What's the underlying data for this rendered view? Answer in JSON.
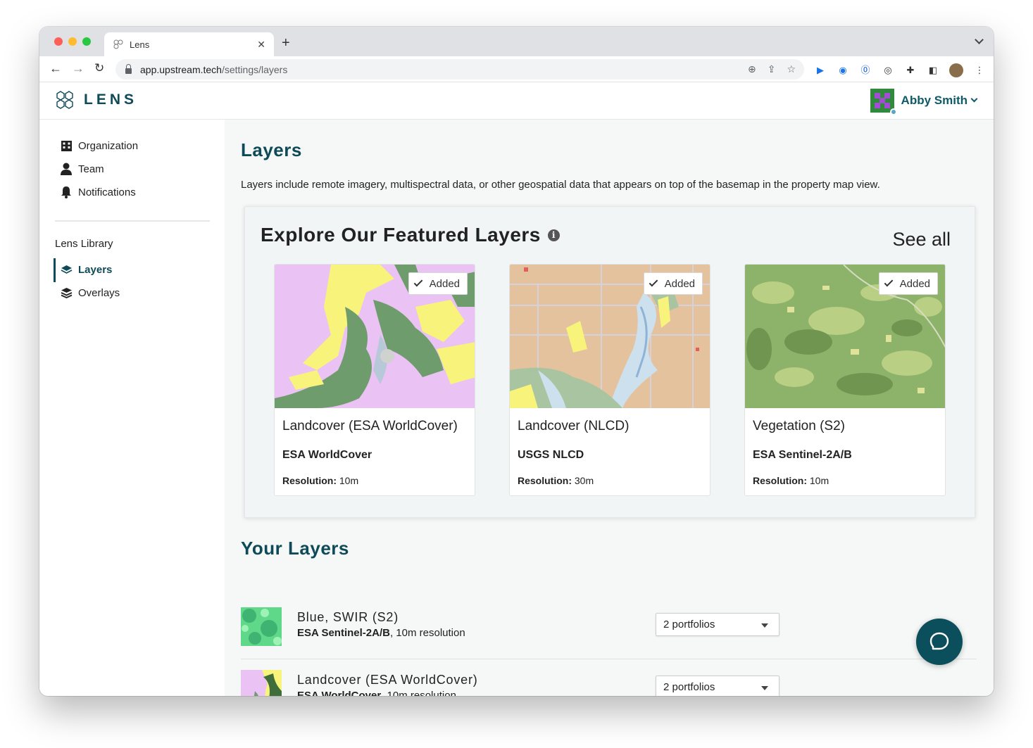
{
  "browser": {
    "tab_title": "Lens",
    "url_host": "app.upstream.tech",
    "url_path": "/settings/layers"
  },
  "app": {
    "logo_text": "LENS",
    "user_name": "Abby Smith"
  },
  "sidebar": {
    "items": [
      {
        "label": "Organization",
        "icon": "building-icon"
      },
      {
        "label": "Team",
        "icon": "person-icon"
      },
      {
        "label": "Notifications",
        "icon": "bell-icon"
      }
    ],
    "library_heading": "Lens Library",
    "library_items": [
      {
        "label": "Layers",
        "icon": "layers-icon",
        "active": true
      },
      {
        "label": "Overlays",
        "icon": "stack-icon",
        "active": false
      }
    ]
  },
  "main": {
    "title": "Layers",
    "description": "Layers include remote imagery, multispectral data, or other geospatial data that appears on top of the basemap in the property map view.",
    "featured": {
      "title": "Explore Our Featured Layers",
      "see_all": "See all",
      "cards": [
        {
          "name": "Landcover (ESA WorldCover)",
          "source": "ESA WorldCover",
          "resolution_label": "Resolution:",
          "resolution": "10m",
          "status": "Added"
        },
        {
          "name": "Landcover (NLCD)",
          "source": "USGS NLCD",
          "resolution_label": "Resolution:",
          "resolution": "30m",
          "status": "Added"
        },
        {
          "name": "Vegetation (S2)",
          "source": "ESA Sentinel-2A/B",
          "resolution_label": "Resolution:",
          "resolution": "10m",
          "status": "Added"
        }
      ]
    },
    "your_layers": {
      "title": "Your Layers",
      "rows": [
        {
          "name": "Blue, SWIR (S2)",
          "source": "ESA Sentinel-2A/B",
          "resolution": ", 10m resolution",
          "portfolios": "2 portfolios"
        },
        {
          "name": "Landcover (ESA WorldCover)",
          "source": "ESA WorldCover",
          "resolution": ", 10m resolution",
          "portfolios": "2 portfolios"
        }
      ]
    }
  },
  "colors": {
    "brand": "#0e4a57",
    "chat_button": "#0c4f5c"
  }
}
